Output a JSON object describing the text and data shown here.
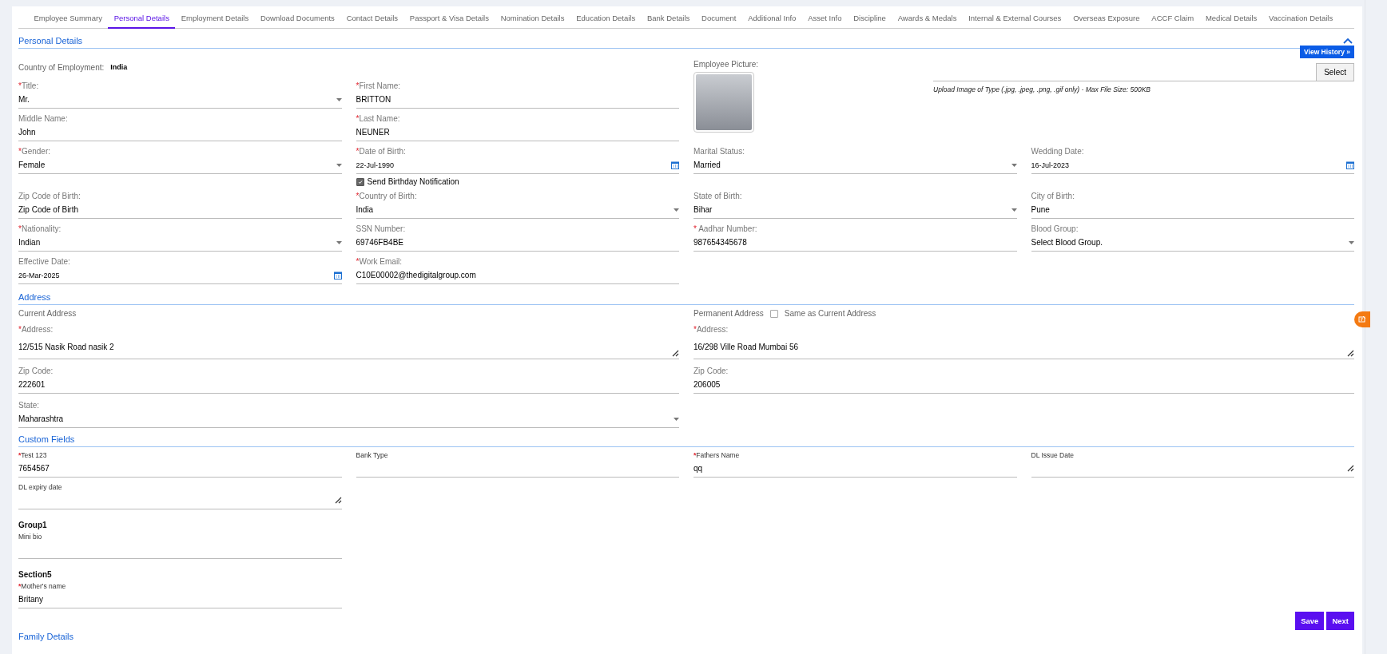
{
  "tabs": [
    {
      "label": "Employee Summary",
      "selected": false
    },
    {
      "label": "Personal Details",
      "selected": true
    },
    {
      "label": "Employment Details",
      "selected": false
    },
    {
      "label": "Download Documents",
      "selected": false
    },
    {
      "label": "Contact Details",
      "selected": false
    },
    {
      "label": "Passport & Visa Details",
      "selected": false
    },
    {
      "label": "Nomination Details",
      "selected": false
    },
    {
      "label": "Education Details",
      "selected": false
    },
    {
      "label": "Bank Details",
      "selected": false
    },
    {
      "label": "Document",
      "selected": false
    },
    {
      "label": "Additional Info",
      "selected": false
    },
    {
      "label": "Asset Info",
      "selected": false
    },
    {
      "label": "Discipline",
      "selected": false
    },
    {
      "label": "Awards & Medals",
      "selected": false
    },
    {
      "label": "Internal & External Courses",
      "selected": false
    },
    {
      "label": "Overseas Exposure",
      "selected": false
    },
    {
      "label": "ACCF Claim",
      "selected": false
    },
    {
      "label": "Medical Details",
      "selected": false
    },
    {
      "label": "Vaccination Details",
      "selected": false
    }
  ],
  "personal": {
    "title": "Personal Details",
    "expanded": true,
    "view_history": "View History »",
    "country_of_employment": {
      "label": "Country of Employment:",
      "value": "India"
    },
    "picture": {
      "label": "Employee Picture:",
      "select_button": "Select",
      "hint": "Upload Image of Type (.jpg, .jpeg, .png, .gif only) - Max File Size: 500KB"
    },
    "fields": [
      {
        "kind": "select",
        "required": "*",
        "label": "Title:",
        "value": "Mr."
      },
      {
        "kind": "text",
        "required": "*",
        "label": "First Name:",
        "value": "BRITTON"
      },
      {
        "kind": "text",
        "label": "Middle Name:",
        "value": "John"
      },
      {
        "kind": "text",
        "required": "*",
        "label": "Last Name:",
        "value": "NEUNER"
      },
      {
        "kind": "select",
        "required": "*",
        "label": "Gender:",
        "value": "Female"
      },
      {
        "kind": "date",
        "required": "*",
        "label": "Date of Birth:",
        "value": "22-Jul-1990",
        "checkbox": {
          "label": "Send Birthday Notification",
          "checked": true
        }
      },
      {
        "kind": "select",
        "label": "Marital Status:",
        "value": "Married"
      },
      {
        "kind": "date",
        "label": "Wedding Date:",
        "value": "16-Jul-2023"
      },
      {
        "kind": "text",
        "label": "Zip Code of Birth:",
        "value": "Zip Code of Birth"
      },
      {
        "kind": "select",
        "required": "*",
        "label": "Country of Birth:",
        "value": "India"
      },
      {
        "kind": "select",
        "label": "State of Birth:",
        "value": "Bihar"
      },
      {
        "kind": "text",
        "label": "City of Birth:",
        "value": "Pune"
      },
      {
        "kind": "select",
        "required": "*",
        "label": "Nationality:",
        "value": "Indian"
      },
      {
        "kind": "text",
        "label": "SSN Number:",
        "value": "69746FB4BE"
      },
      {
        "kind": "text",
        "required": "*",
        "label": " Aadhar Number:",
        "value": "987654345678"
      },
      {
        "kind": "select",
        "label": "Blood Group:",
        "value": "Select Blood Group."
      },
      {
        "kind": "date",
        "label": "Effective Date:",
        "value": "26-Mar-2025"
      },
      {
        "kind": "text",
        "required": "*",
        "label": "Work Email:",
        "value": "C10E00002@thedigitalgroup.com"
      }
    ]
  },
  "address": {
    "title": "Address",
    "current": {
      "caption": "Current Address",
      "fields": [
        {
          "kind": "textarea",
          "required": "*",
          "label": "Address:",
          "value": "12/515 Nasik Road nasik 2"
        },
        {
          "kind": "text",
          "label": "Zip Code:",
          "value": "222601"
        },
        {
          "kind": "select",
          "label": "State:",
          "value": "Maharashtra"
        }
      ]
    },
    "permanent": {
      "caption": "Permanent Address",
      "same_as_current": {
        "label": "Same as Current Address",
        "checked": false
      },
      "fields": [
        {
          "kind": "textarea",
          "required": "*",
          "label": "Address:",
          "value": "16/298 Ville Road Mumbai 56"
        },
        {
          "kind": "text",
          "label": "Zip Code:",
          "value": "206005"
        }
      ]
    }
  },
  "custom_fields": {
    "title": "Custom Fields",
    "fields": [
      {
        "kind": "text",
        "required": "*",
        "label": "Test 123",
        "value": "7654567"
      },
      {
        "kind": "text",
        "label": "Bank Type"
      },
      {
        "kind": "text",
        "required": "*",
        "label": "Fathers Name",
        "value": "qq"
      },
      {
        "kind": "textarea",
        "label": "DL Issue Date"
      },
      {
        "kind": "textarea",
        "label": "DL expiry date"
      }
    ],
    "groups": [
      {
        "title": "Group1",
        "fields": [
          {
            "kind": "text",
            "label": "Mini bio"
          }
        ]
      },
      {
        "title": "Section5",
        "fields": [
          {
            "kind": "text",
            "required": "*",
            "label": "Mother's name",
            "value": "Britany"
          }
        ]
      }
    ]
  },
  "buttons": [
    "Save",
    "Next"
  ],
  "next_section": "Family Details"
}
